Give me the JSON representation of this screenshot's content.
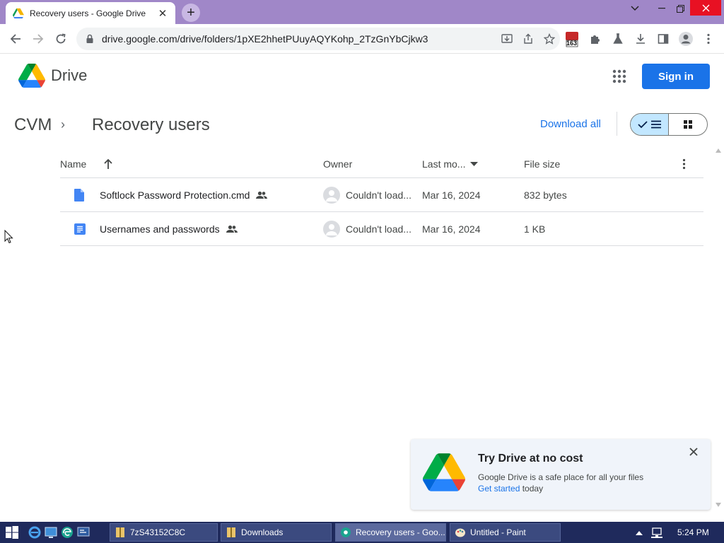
{
  "browser": {
    "tab_title": "Recovery users - Google Drive",
    "tab_close": "✕",
    "new_tab": "+",
    "url": "drive.google.com/drive/folders/1pXE2hhetPUuyAQYKohp_2TzGnYbCjkw3"
  },
  "extensions": {
    "badge": "163"
  },
  "drive": {
    "brand": "Drive",
    "sign_in": "Sign in"
  },
  "breadcrumb": {
    "root": "CVM",
    "separator": "›",
    "current": "Recovery users"
  },
  "actions": {
    "download_all": "Download all"
  },
  "table": {
    "headers": {
      "name": "Name",
      "owner": "Owner",
      "last_modified": "Last mo...",
      "file_size": "File size"
    },
    "rows": [
      {
        "name": "Softlock Password Protection.cmd",
        "owner": "Couldn't load...",
        "last_modified": "Mar 16, 2024",
        "file_size": "832 bytes"
      },
      {
        "name": "Usernames and passwords",
        "owner": "Couldn't load...",
        "last_modified": "Mar 16, 2024",
        "file_size": "1 KB"
      }
    ]
  },
  "promo": {
    "title": "Try Drive at no cost",
    "body": "Google Drive is a safe place for all your files",
    "link": "Get started",
    "suffix": " today"
  },
  "taskbar": {
    "items": [
      {
        "label": "7zS43152C8C"
      },
      {
        "label": "Downloads"
      },
      {
        "label": "Recovery users - Goo..."
      },
      {
        "label": "Untitled - Paint"
      }
    ],
    "clock": "5:24 PM"
  },
  "colors": {
    "accent": "#1a73e8",
    "tabstrip": "#a087c8",
    "selected_view": "#c2e7ff",
    "taskbar": "#1f2a5c"
  }
}
